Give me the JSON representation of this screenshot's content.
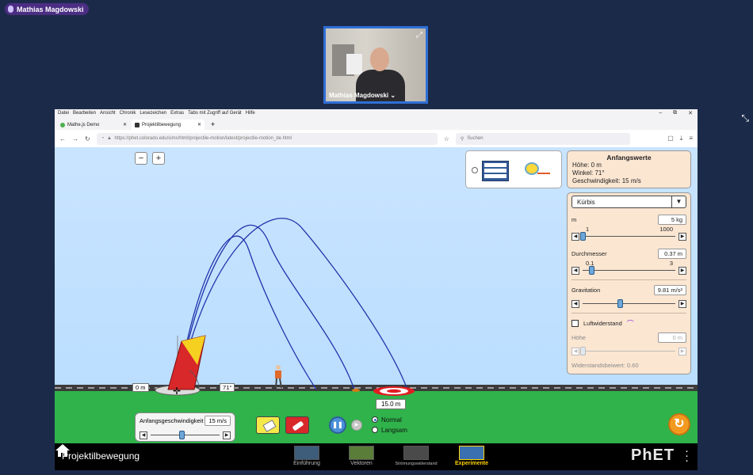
{
  "meeting": {
    "presenter_name": "Mathias Magdowski",
    "video_name": "Mathias Magdowski ⌄"
  },
  "browser": {
    "menu": [
      "Datei",
      "Bearbeiten",
      "Ansicht",
      "Chronik",
      "Lesezeichen",
      "Extras",
      "Tabs mit Zugriff auf Gerät",
      "Hilfe"
    ],
    "window_controls": [
      "–",
      "⧉",
      "✕"
    ],
    "tabs": [
      {
        "label": "Mathe.js Demo",
        "active": false
      },
      {
        "label": "Projektilbewegung",
        "active": true
      }
    ],
    "new_tab": "+",
    "url": "https://phet.colorado.edu/sims/html/projectile-motion/latest/projectile-motion_de.html",
    "search_placeholder": "Suchen"
  },
  "sim": {
    "zoom_out": "−",
    "zoom_in": "+",
    "initial_values": {
      "title": "Anfangswerte",
      "height": "Höhe: 0 m",
      "angle": "Winkel: 71°",
      "speed": "Geschwindigkeit: 15 m/s"
    },
    "projectile_select": "Kürbis",
    "mass": {
      "label": "m",
      "value": "5 kg",
      "min": "1",
      "max": "1000",
      "fraction": 0.0
    },
    "diameter": {
      "label": "Durchmesser",
      "value": "0.37 m",
      "min": "0.1",
      "max": "3",
      "fraction": 0.09
    },
    "gravity": {
      "label": "Gravitation",
      "value": "9.81 m/s²",
      "fraction": 0.4
    },
    "air_resistance": {
      "label": "Luftwiderstand",
      "checked": false
    },
    "altitude": {
      "label": "Höhe",
      "value": "0 m",
      "fraction": 0.0
    },
    "drag_coefficient": "Widerstandsbeiwert: 0.60",
    "height_label": "0 m",
    "angle_label": "71°",
    "target_distance": "15.0 m",
    "launch_speed": {
      "label": "Anfangsgeschwindigkeit",
      "value": "15 m/s",
      "fraction": 0.45
    },
    "sim_speed": {
      "normal": "Normal",
      "slow": "Langsam",
      "selected": "Normal"
    },
    "colors": {
      "trajectory": "#2233aa",
      "ground": "#2fb34a",
      "sky": "#b6dcff",
      "cannon": "#d8282a"
    }
  },
  "nav": {
    "title": "Projektilbewegung",
    "screens": [
      "Einführung",
      "Vektoren",
      "Strömungswiderstand",
      "Experimente"
    ],
    "active_screen": "Experimente",
    "logo": "PhET"
  }
}
